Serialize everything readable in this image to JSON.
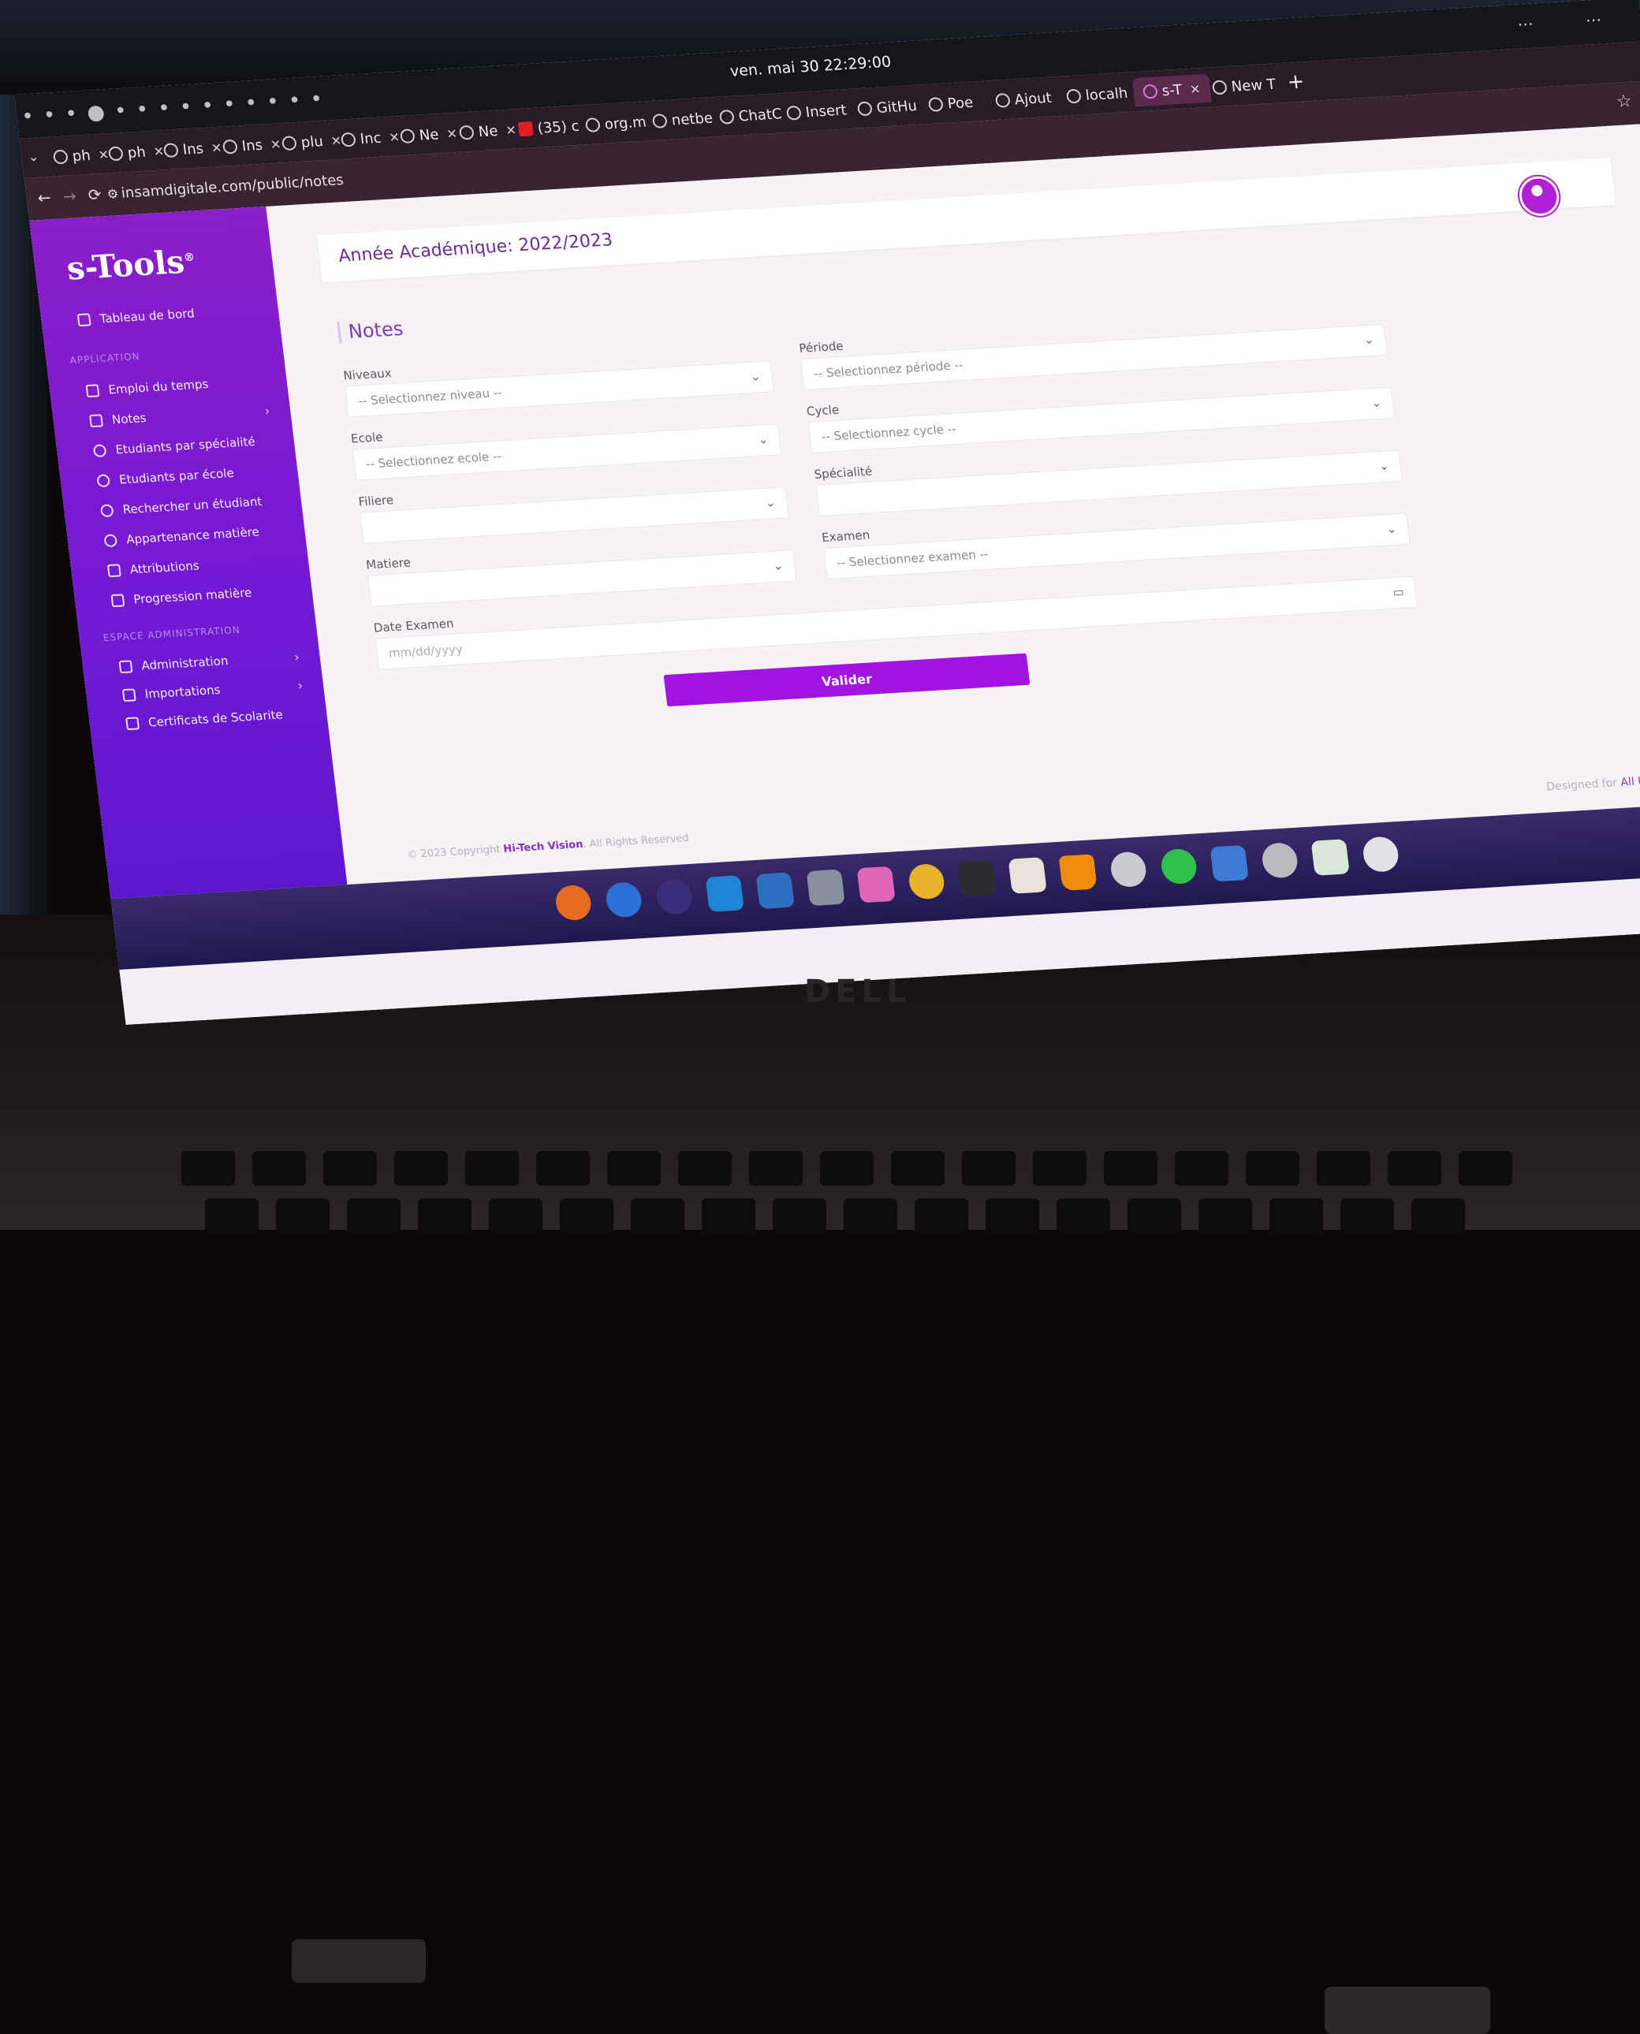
{
  "system": {
    "clock": "ven. mai 30  22:29:00"
  },
  "browser": {
    "tabs": [
      {
        "label": "ph",
        "icon": "php-icon"
      },
      {
        "label": "ph",
        "icon": "php-icon"
      },
      {
        "label": "Ins",
        "icon": "phone-icon"
      },
      {
        "label": "Ins",
        "icon": "phone-icon"
      },
      {
        "label": "plu",
        "icon": "generic-site-icon"
      },
      {
        "label": "Inc",
        "icon": "github-icon"
      },
      {
        "label": "Ne",
        "icon": "chrome-icon"
      },
      {
        "label": "Ne",
        "icon": "shield-icon"
      },
      {
        "label": "(35) c",
        "icon": "youtube-icon"
      },
      {
        "label": "org.m",
        "icon": "generic-site-icon"
      },
      {
        "label": "netbe",
        "icon": "generic-site-icon"
      },
      {
        "label": "ChatC",
        "icon": "openai-icon"
      },
      {
        "label": "Insert",
        "icon": "generic-site-icon"
      },
      {
        "label": "GitHu",
        "icon": "github-icon"
      },
      {
        "label": "Poe",
        "icon": "chat-icon"
      },
      {
        "label": "Ajout",
        "icon": "generic-site-icon"
      },
      {
        "label": "localh",
        "icon": "generic-site-icon"
      },
      {
        "label": "s-T",
        "icon": "s-tools-icon",
        "active": true
      },
      {
        "label": "New T",
        "icon": "chrome-icon"
      }
    ],
    "url": "insamdigitale.com/public/notes"
  },
  "sidebar": {
    "logo": "s-Tools",
    "items": [
      {
        "label": "Tableau de bord",
        "icon": "home-icon"
      },
      {
        "label": "Emploi du temps",
        "icon": "calendar-icon"
      },
      {
        "label": "Notes",
        "icon": "notes-icon",
        "has_submenu": true
      },
      {
        "label": "Etudiants par spécialité",
        "icon": "users-icon"
      },
      {
        "label": "Etudiants par école",
        "icon": "users-icon"
      },
      {
        "label": "Rechercher un étudiant",
        "icon": "search-icon"
      },
      {
        "label": "Appartenance matière",
        "icon": "pie-icon"
      },
      {
        "label": "Attributions",
        "icon": "attribution-icon"
      },
      {
        "label": "Progression matière",
        "icon": "progress-icon"
      },
      {
        "label": "Administration",
        "icon": "admin-icon",
        "has_submenu": true
      },
      {
        "label": "Importations",
        "icon": "import-icon",
        "has_submenu": true
      },
      {
        "label": "Certificats de Scolarite",
        "icon": "certificate-icon"
      }
    ],
    "section_application": "APPLICATION",
    "section_admin": "ESPACE ADMINISTRATION"
  },
  "header": {
    "academic_year": "Année Académique: 2022/2023"
  },
  "form": {
    "title": "Notes",
    "niveaux": {
      "label": "Niveaux",
      "placeholder": "-- Selectionnez niveau --"
    },
    "periode": {
      "label": "Période",
      "placeholder": "-- Selectionnez période --"
    },
    "ecole": {
      "label": "Ecole",
      "placeholder": "-- Selectionnez ecole --"
    },
    "cycle": {
      "label": "Cycle",
      "placeholder": "-- Selectionnez cycle --"
    },
    "filiere": {
      "label": "Filiere",
      "placeholder": ""
    },
    "specialite": {
      "label": "Spécialité",
      "placeholder": ""
    },
    "matiere": {
      "label": "Matiere",
      "placeholder": ""
    },
    "examen": {
      "label": "Examen",
      "placeholder": "-- Selectionnez examen --"
    },
    "date_examen": {
      "label": "Date Examen",
      "placeholder": "mm/dd/yyyy"
    },
    "submit": "Valider"
  },
  "footer": {
    "copyright_prefix": "© 2023 Copyright ",
    "brand": "Hi-Tech Vision",
    "rights": ". All Rights Reserved",
    "designed_prefix": "Designed for ",
    "designed_for": "All Users"
  },
  "dock": {
    "apps": [
      "firefox-icon",
      "help-icon",
      "eclipse-icon",
      "vscode-icon",
      "writer-icon",
      "files-icon",
      "media-player-icon",
      "chrome-icon",
      "terminal-icon",
      "archive-icon",
      "vlc-icon",
      "software-center-icon",
      "whatsapp-icon",
      "virtualbox-icon",
      "settings-icon",
      "trash-icon",
      "ubuntu-icon"
    ]
  },
  "colors": {
    "accent": "#a313df",
    "sidebar_top": "#8a1ec9",
    "sidebar_bottom": "#5d18cf"
  }
}
